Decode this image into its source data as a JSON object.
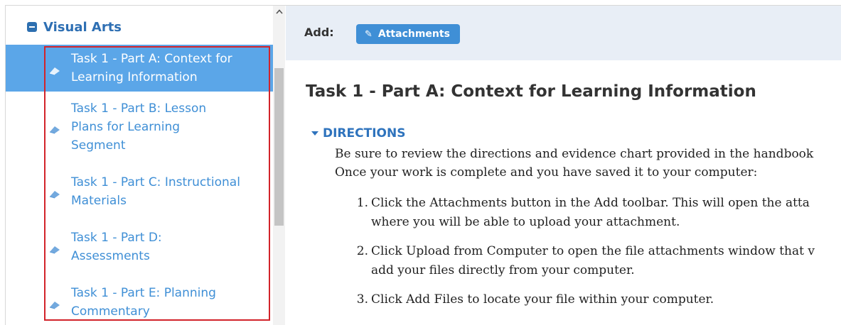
{
  "sidebar": {
    "section_title": "Visual Arts",
    "tasks": [
      {
        "label": "Task 1 - Part A: Context for Learning Information",
        "lines": [
          "Task 1 - Part A: Context for",
          "Learning Information"
        ],
        "active": true
      },
      {
        "label": "Task 1 - Part B: Lesson Plans for Learning Segment",
        "lines": [
          "Task 1 - Part B: Lesson",
          "Plans for Learning",
          "Segment"
        ],
        "active": false
      },
      {
        "label": "Task 1 - Part C: Instructional Materials",
        "lines": [
          "Task 1 - Part C: Instructional",
          "Materials"
        ],
        "active": false
      },
      {
        "label": "Task 1 - Part D: Assessments",
        "lines": [
          "Task 1 - Part D:",
          "Assessments"
        ],
        "active": false
      },
      {
        "label": "Task 1 - Part E: Planning Commentary",
        "lines": [
          "Task 1 - Part E: Planning",
          "Commentary"
        ],
        "active": false
      }
    ],
    "icons": {
      "section_toggle": "minus-square-icon",
      "task": "diamond-icon",
      "scroll": "chevron-up-icon"
    }
  },
  "toolbar": {
    "add_label": "Add:",
    "attachments_label": "Attachments",
    "attachments_icon": "paperclip-icon"
  },
  "main": {
    "page_title": "Task 1 - Part A: Context for Learning Information",
    "directions_label": "DIRECTIONS",
    "intro_lines": [
      "Be sure to review the directions and evidence chart provided in the handbook",
      "Once your work is complete and you have saved it to your computer:"
    ],
    "steps": [
      {
        "num": "1.",
        "lines": [
          "Click the Attachments button in the Add toolbar. This will open the atta",
          "where you will be able to upload your attachment."
        ]
      },
      {
        "num": "2.",
        "lines": [
          "Click Upload from Computer to open the file attachments window that v",
          "add your files directly from your computer."
        ]
      },
      {
        "num": "3.",
        "lines": [
          "Click Add Files to locate your file within your computer."
        ]
      }
    ]
  },
  "colors": {
    "accent": "#3f8fd6",
    "active_bg": "#5ba6e8",
    "toolbar_bg": "#e8eef6",
    "highlight_border": "#d2232a",
    "section_title": "#2e6fb3"
  }
}
